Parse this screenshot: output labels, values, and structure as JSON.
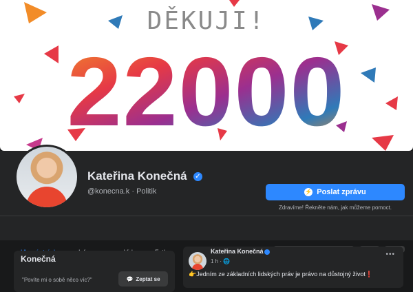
{
  "cover": {
    "headline": "DĚKUJI!",
    "number": "22000",
    "colors": {
      "orange": "#f28c28",
      "red": "#e63946",
      "purple": "#9b2f8f",
      "blue": "#2f7ab8",
      "pink": "#c73a8c"
    }
  },
  "profile": {
    "name": "Kateřina Konečná",
    "handle": "@konecna.k · Politik",
    "message_button": "Poslat zprávu",
    "message_hint": "Zdravíme! Řekněte nám, jak můžeme pomoct."
  },
  "tabs": [
    {
      "label": "Hlavní stránka",
      "active": true
    },
    {
      "label": "Informace",
      "active": false
    },
    {
      "label": "Videa",
      "active": false
    },
    {
      "label": "Fotky",
      "active": false
    }
  ],
  "sidebar_card": {
    "title": "Konečná",
    "quote": "\"Povíte mi o sobě něco víc?\"",
    "ask_button": "Zeptat se"
  },
  "post": {
    "author": "Kateřina Konečná",
    "time": "1 h · ",
    "text": "👉Jedním ze základních lidských práv je právo na důstojný život❗"
  }
}
